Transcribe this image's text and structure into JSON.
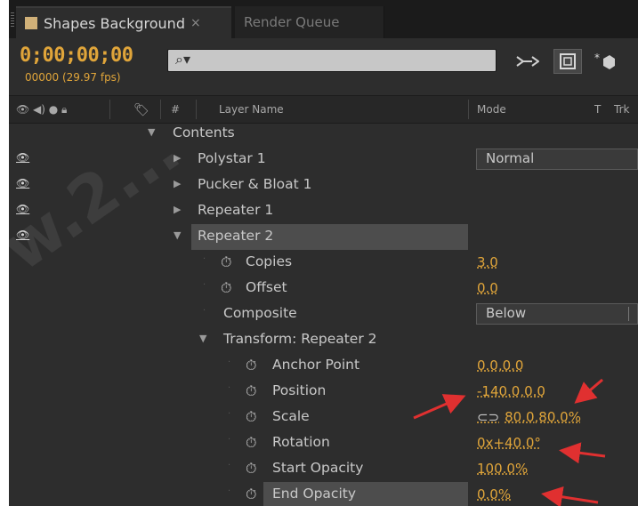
{
  "tabs": [
    {
      "label": "Shapes Background",
      "close": "×",
      "active": true
    },
    {
      "label": "Render Queue",
      "active": false
    }
  ],
  "header": {
    "timecode": "0;00;00;00",
    "frames": "00000 (29.97 fps)",
    "search_placeholder": "",
    "buttons": [
      "flowchart-icon",
      "comp-mini-icon",
      "draft-3d-icon"
    ]
  },
  "columns": {
    "switches": "",
    "number": "#",
    "layer_name": "Layer Name",
    "mode": "Mode",
    "t": "T",
    "trkmat": "Trk"
  },
  "rows": [
    {
      "label": "Contents",
      "expanded": true
    },
    {
      "label": "Polystar 1",
      "expanded": false,
      "visible": true,
      "mode": "Normal"
    },
    {
      "label": "Pucker & Bloat 1",
      "expanded": false,
      "visible": true
    },
    {
      "label": "Repeater 1",
      "expanded": false,
      "visible": true
    },
    {
      "label": "Repeater 2",
      "expanded": true,
      "visible": true,
      "selected": true
    },
    {
      "label": "Copies",
      "value": "3.0"
    },
    {
      "label": "Offset",
      "value": "0.0"
    },
    {
      "label": "Composite",
      "dropdown": "Below"
    },
    {
      "label": "Transform: Repeater 2",
      "expanded": true
    },
    {
      "label": "Anchor Point",
      "value": "0.0,0.0"
    },
    {
      "label": "Position",
      "value": "-140.0,0.0"
    },
    {
      "label": "Scale",
      "value": "80.0,80.0%",
      "linked": true
    },
    {
      "label": "Rotation",
      "value": "0x+40.0°"
    },
    {
      "label": "Start Opacity",
      "value": "100.0%"
    },
    {
      "label": "End Opacity",
      "value": "0.0%",
      "selected": true
    }
  ],
  "colors": {
    "accent": "#e0a53a",
    "annotation": "#e03030",
    "panel": "#2d2d2d"
  }
}
